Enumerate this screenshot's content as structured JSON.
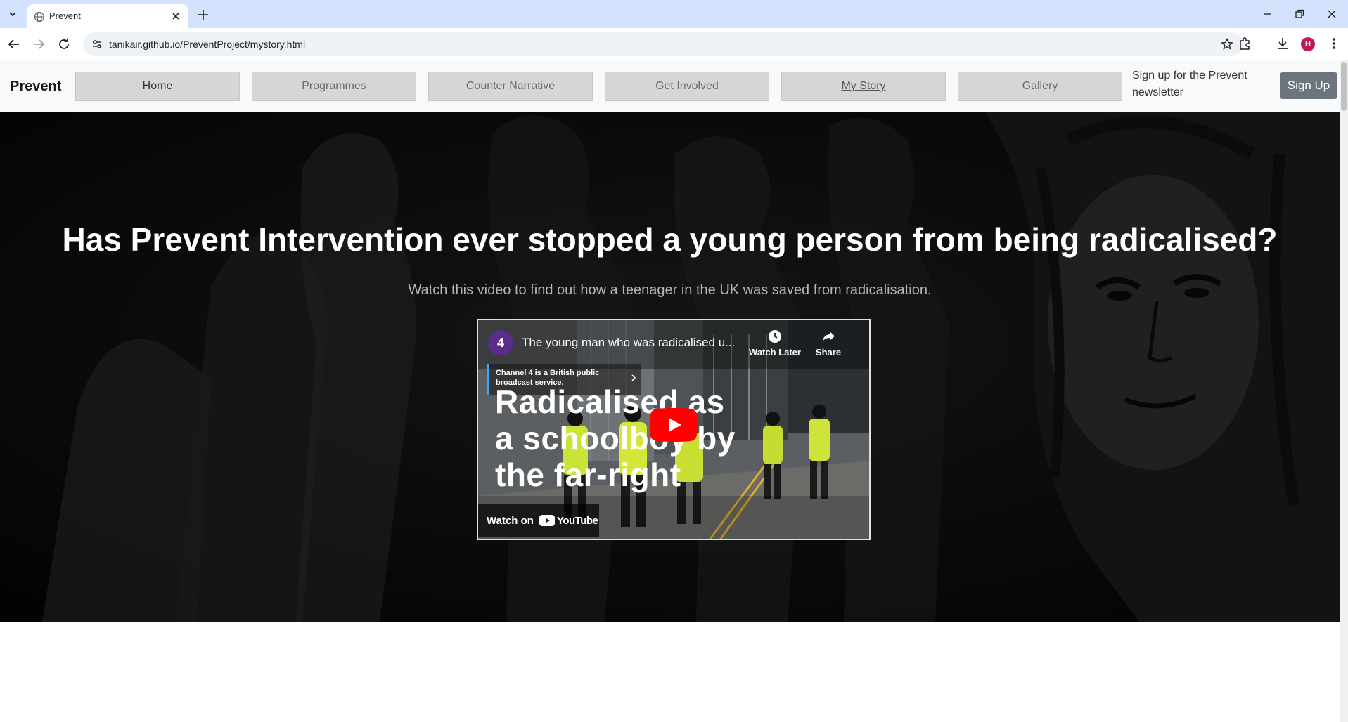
{
  "browser": {
    "tab_title": "Prevent",
    "url": "tanikair.github.io/PreventProject/mystory.html",
    "profile_initial": "H"
  },
  "nav": {
    "brand": "Prevent",
    "items": [
      {
        "label": "Home"
      },
      {
        "label": "Programmes"
      },
      {
        "label": "Counter Narrative"
      },
      {
        "label": "Get Involved"
      },
      {
        "label": "My Story"
      },
      {
        "label": "Gallery"
      }
    ],
    "newsletter_text": "Sign up for the Prevent newsletter",
    "signup_label": "Sign Up"
  },
  "hero": {
    "title": "Has Prevent Intervention ever stopped a young person from being radicalised?",
    "subtitle": "Watch this video to find out how a teenager in the UK was saved from radicalisation."
  },
  "video": {
    "title": "The young man who was radicalised u...",
    "channel_initial": "4",
    "watch_later_label": "Watch Later",
    "share_label": "Share",
    "info_text": "Channel 4 is a British public broadcast service.",
    "overlay_text": "Radicalised as a schoolboy by the far-right",
    "watch_on_label": "Watch on",
    "youtube_label": "YouTube"
  },
  "colors": {
    "chrome_tab_bar": "#d3e3fd",
    "navbar_bg": "#f8f9fa",
    "nav_button_bg": "#d6d6d6",
    "signup_bg": "#6c757d",
    "hero_bg": "#0e0e0e",
    "youtube_red": "#ff0000"
  }
}
